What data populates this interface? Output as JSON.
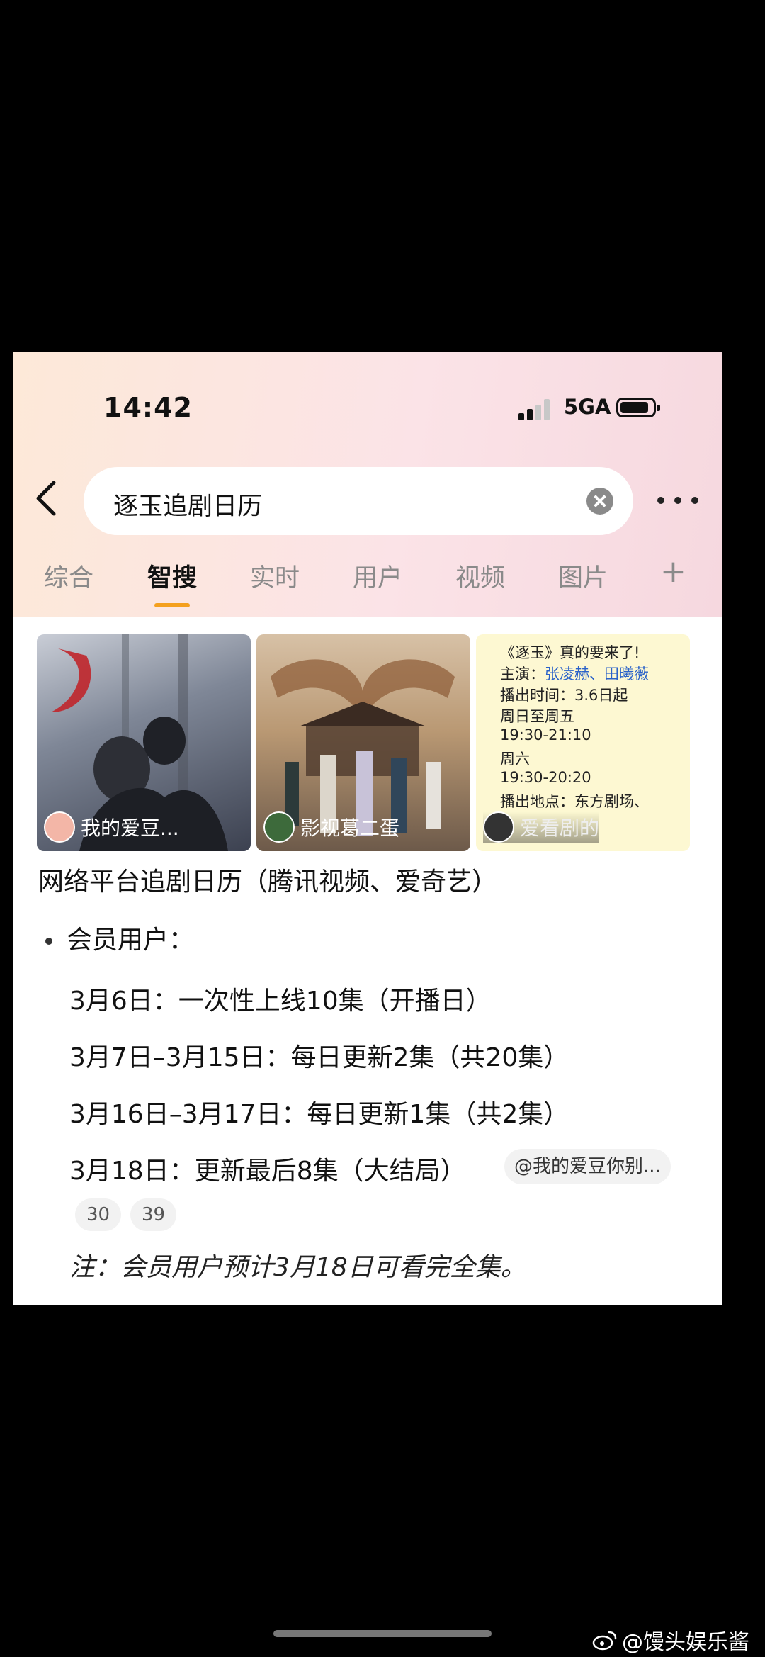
{
  "status": {
    "time": "14:42",
    "network": "5GA"
  },
  "search": {
    "query": "逐玉追剧日历"
  },
  "tabs": [
    "综合",
    "智搜",
    "实时",
    "用户",
    "视频",
    "图片",
    "+"
  ],
  "cards": [
    {
      "source": "我的爱豆..."
    },
    {
      "source": "影视葛二蛋"
    },
    {
      "source": "爱看剧的",
      "lines": [
        "《逐玉》真的要来了!",
        "主演：",
        "张凌赫、田曦薇",
        "播出时间：3.6日起",
        "周日至周五",
        "19:30-21:10",
        "周六",
        "19:30-20:20",
        "播出地点：东方剧场、"
      ]
    }
  ],
  "content": {
    "title": "网络平台追剧日历（腾讯视频、爱奇艺）",
    "bullet": "会员用户：",
    "rows": [
      "3月6日：一次性上线10集（开播日）",
      "3月7日–3月15日：每日更新2集（共20集）",
      "3月16日–3月17日：每日更新1集（共2集）",
      "3月18日：更新最后8集（大结局）"
    ],
    "tag": "@我的爱豆你别...",
    "pills": [
      "30",
      "39"
    ],
    "note": "注：会员用户预计3月18日可看完全集。"
  },
  "watermark": "@馒头娱乐酱"
}
